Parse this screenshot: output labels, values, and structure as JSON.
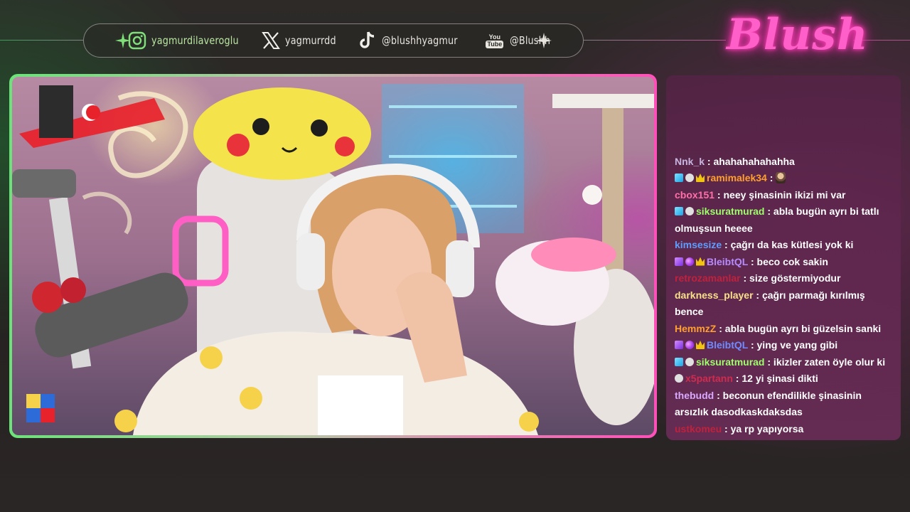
{
  "social": {
    "instagram": "yagmurdilaveroglu",
    "x": "yagmurrdd",
    "tiktok": "@blushhyagmur",
    "youtube_icon_top": "You",
    "youtube_icon_bottom": "Tube",
    "youtube": "@Blushh"
  },
  "logo": {
    "text": "Blush",
    "color": "#ff5fc8"
  },
  "colors": {
    "frame_green": "#6de27a",
    "frame_pink": "#ff4fb8",
    "chat_bg": "#6e2d5a"
  },
  "chat": {
    "messages": [
      {
        "user": "Nnk_k",
        "color": "#c9b6e0",
        "text": " : ahahahahahahha",
        "badges": []
      },
      {
        "user": "ramimalek34",
        "color": "#ffa02e",
        "text": " : ",
        "badges": [
          "cube",
          "chat",
          "crown"
        ],
        "emote": true
      },
      {
        "user": "cbox151",
        "color": "#ff6fa8",
        "text": " : neey şinasinin ikizi mi var",
        "badges": []
      },
      {
        "user": "siksuratmurad",
        "color": "#9dff6a",
        "text": " : abla bugün ayrı bi tatlı olmuşsun heeee",
        "badges": [
          "cube",
          "chat"
        ]
      },
      {
        "user": "kimsesize",
        "color": "#5e9dff",
        "text": " : çağrı da kas kütlesi yok ki",
        "badges": []
      },
      {
        "user": "BleibtQL",
        "color": "#b58bff",
        "text": " : beco cok sakin",
        "badges": [
          "purple",
          "moon",
          "crown"
        ]
      },
      {
        "user": "retrozamanlar",
        "color": "#c0213d",
        "text": " : size göstermiyodur",
        "badges": []
      },
      {
        "user": "darkness_player",
        "color": "#f7e08a",
        "text": " : çağrı parmağı kırılmış bence",
        "badges": []
      },
      {
        "user": "HemmzZ",
        "color": "#ffa02e",
        "text": " : abla bugün ayrı bi güzelsin sanki",
        "badges": []
      },
      {
        "user": "BleibtQL",
        "color": "#6e8bff",
        "text": " : ying ve yang gibi",
        "badges": [
          "purple",
          "moon",
          "crown"
        ]
      },
      {
        "user": "siksuratmurad",
        "color": "#9dff6a",
        "text": " : ikizler zaten öyle olur ki",
        "badges": [
          "cube",
          "chat"
        ]
      },
      {
        "user": "x5partann",
        "color": "#d12a4f",
        "text": " : 12 yi şinasi dikti",
        "badges": [
          "chat"
        ]
      },
      {
        "user": "thebudd",
        "color": "#d9a8ff",
        "text": " : beconun efendilikle şinasinin arsızlık dasodkaskdaksdas",
        "badges": []
      },
      {
        "user": "ustkomeu",
        "color": "#c0213d",
        "text": " : ya rp yapıyorsa",
        "badges": []
      }
    ]
  }
}
